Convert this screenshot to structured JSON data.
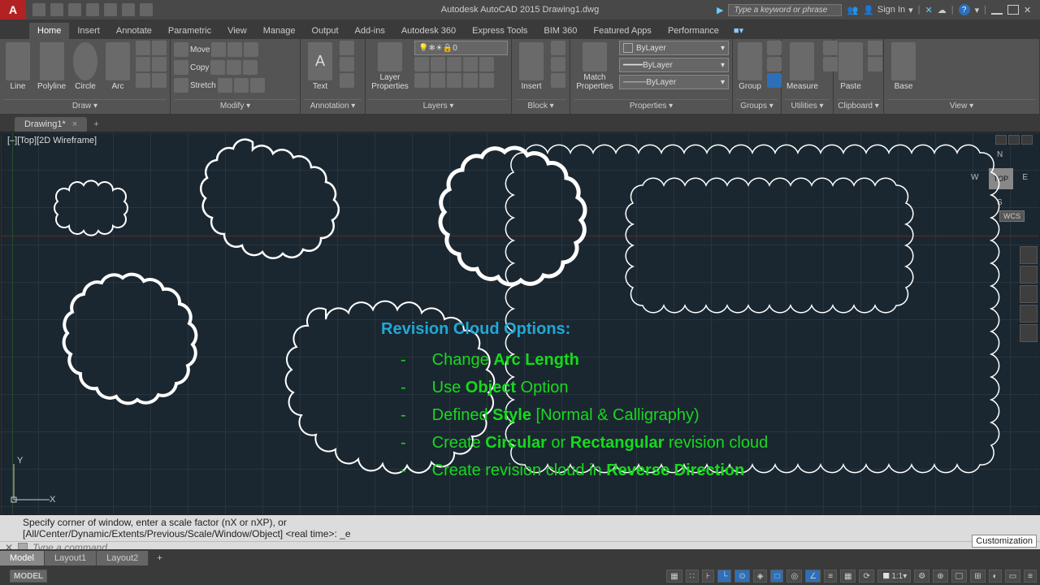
{
  "titlebar": {
    "logo_letter": "A",
    "app_title": "Autodesk AutoCAD 2015   Drawing1.dwg",
    "search_placeholder": "Type a keyword or phrase",
    "sign_in": "Sign In",
    "help_char": "?"
  },
  "ribbon_tabs": [
    "Home",
    "Insert",
    "Annotate",
    "Parametric",
    "View",
    "Manage",
    "Output",
    "Add-ins",
    "Autodesk 360",
    "Express Tools",
    "BIM 360",
    "Featured Apps",
    "Performance"
  ],
  "ribbon_active": "Home",
  "ribbon_panels": {
    "draw": {
      "label": "Draw ▾",
      "items": [
        "Line",
        "Polyline",
        "Circle",
        "Arc"
      ]
    },
    "modify": {
      "label": "Modify ▾",
      "rows": [
        "Move",
        "Copy",
        "Stretch"
      ]
    },
    "annotation": {
      "label": "Annotation ▾",
      "text_btn": "Text"
    },
    "layers": {
      "label": "Layers ▾",
      "btn": "Layer\nProperties",
      "current": "0"
    },
    "block": {
      "label": "Block ▾",
      "btn": "Insert"
    },
    "properties": {
      "label": "Properties ▾",
      "btn": "Match\nProperties",
      "bylayer": "ByLayer"
    },
    "groups": {
      "label": "Groups ▾",
      "btn": "Group"
    },
    "utilities": {
      "label": "Utilities ▾",
      "btn": "Measure"
    },
    "clipboard": {
      "label": "Clipboard ▾",
      "btn": "Paste"
    },
    "view": {
      "label": "View ▾",
      "btn": "Base"
    }
  },
  "doc_tab": {
    "name": "Drawing1*",
    "close": "×",
    "add": "+"
  },
  "viewport": {
    "label": "[–][Top][2D Wireframe]",
    "nav": {
      "face": "TOP",
      "n": "N",
      "s": "S",
      "e": "E",
      "w": "W"
    },
    "wcs": "WCS",
    "axes": {
      "x": "X",
      "y": "Y"
    }
  },
  "overlay": {
    "title": "Revision Cloud Options:",
    "lines": [
      {
        "pre": "Change ",
        "b": "Arc Length",
        "post": ""
      },
      {
        "pre": "Use ",
        "b": "Object",
        "post": " Option"
      },
      {
        "pre": "Defined ",
        "b": "Style",
        "post": " [Normal & Calligraphy)"
      },
      {
        "pre": "Create ",
        "b": "Circular",
        "mid": " or ",
        "b2": "Rectangular",
        "post": " revision cloud"
      },
      {
        "pre": "Create revision cloud in ",
        "b": "Reverse Direction",
        "post": ""
      }
    ]
  },
  "cmd": {
    "hist1": "Specify corner of window, enter a scale factor (nX or nXP), or",
    "hist2": "[All/Center/Dynamic/Extents/Previous/Scale/Window/Object] <real time>: _e",
    "placeholder": "Type a command",
    "custom_btn": "Customization"
  },
  "layout_tabs": [
    "Model",
    "Layout1",
    "Layout2"
  ],
  "status": {
    "model": "MODEL",
    "scale": "1:1"
  }
}
